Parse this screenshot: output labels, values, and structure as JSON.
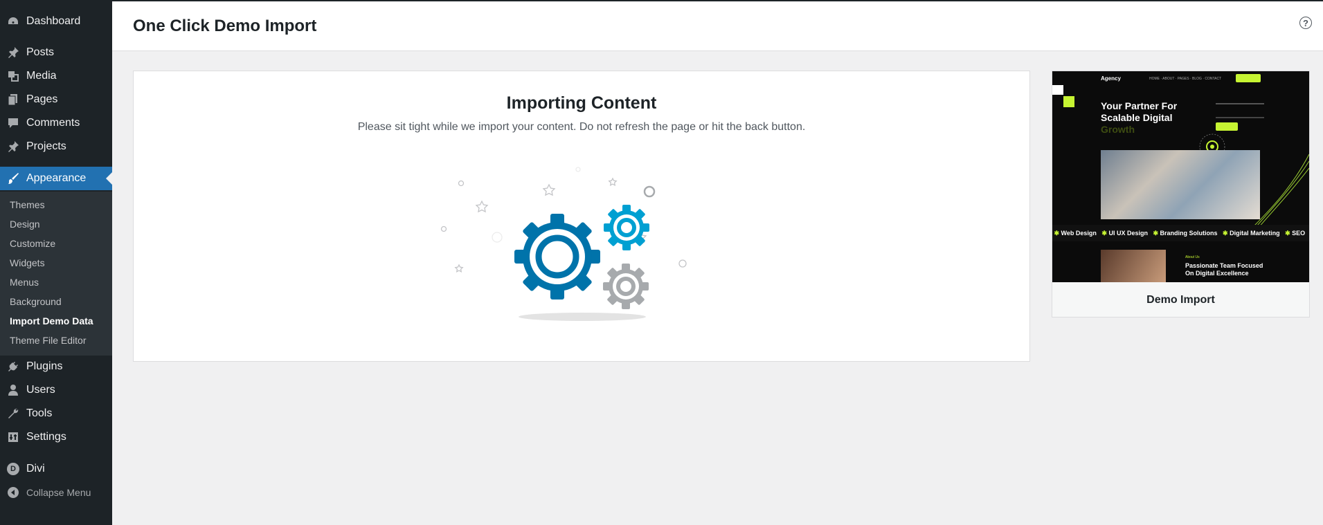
{
  "sidebar": {
    "items": [
      {
        "label": "Dashboard",
        "icon": "dashboard-icon"
      },
      {
        "label": "Posts",
        "icon": "pin-icon"
      },
      {
        "label": "Media",
        "icon": "media-icon"
      },
      {
        "label": "Pages",
        "icon": "pages-icon"
      },
      {
        "label": "Comments",
        "icon": "comments-icon"
      },
      {
        "label": "Projects",
        "icon": "pin-icon"
      },
      {
        "label": "Appearance",
        "icon": "brush-icon"
      },
      {
        "label": "Plugins",
        "icon": "plugin-icon"
      },
      {
        "label": "Users",
        "icon": "users-icon"
      },
      {
        "label": "Tools",
        "icon": "wrench-icon"
      },
      {
        "label": "Settings",
        "icon": "settings-icon"
      },
      {
        "label": "Divi",
        "icon": "divi-icon",
        "icon_letter": "D"
      },
      {
        "label": "Collapse Menu",
        "icon": "collapse-icon"
      }
    ],
    "submenu": [
      {
        "label": "Themes"
      },
      {
        "label": "Design"
      },
      {
        "label": "Customize"
      },
      {
        "label": "Widgets"
      },
      {
        "label": "Menus"
      },
      {
        "label": "Background"
      },
      {
        "label": "Import Demo Data"
      },
      {
        "label": "Theme File Editor"
      }
    ],
    "active_item": "Appearance",
    "current_subitem": "Import Demo Data"
  },
  "header": {
    "title": "One Click Demo Import",
    "help_symbol": "?"
  },
  "main": {
    "title": "Importing Content",
    "subtitle": "Please sit tight while we import your content. Do not refresh the page or hit the back button."
  },
  "preview": {
    "label": "Demo Import",
    "thumbnail": {
      "logo": "Agency",
      "nav": "HOME · ABOUT · PAGES · BLOG · CONTACT",
      "headline_line1": "Your Partner For",
      "headline_line2": "Scalable Digital",
      "headline_line3": "Growth",
      "ticker": [
        "Web Design",
        "UI UX Design",
        "Branding Solutions",
        "Digital Marketing",
        "SEO"
      ],
      "section_kicker": "About Us",
      "section_line1": "Passionate Team Focused",
      "section_line2": "On Digital Excellence"
    }
  },
  "colors": {
    "sidebar_bg": "#1d2327",
    "submenu_bg": "#2c3338",
    "active_bg": "#2271b1",
    "gear_blue": "#0073aa",
    "gear_light_blue": "#00a0d2",
    "gear_gray": "#a7aaad",
    "accent_lime": "#c6f432"
  }
}
